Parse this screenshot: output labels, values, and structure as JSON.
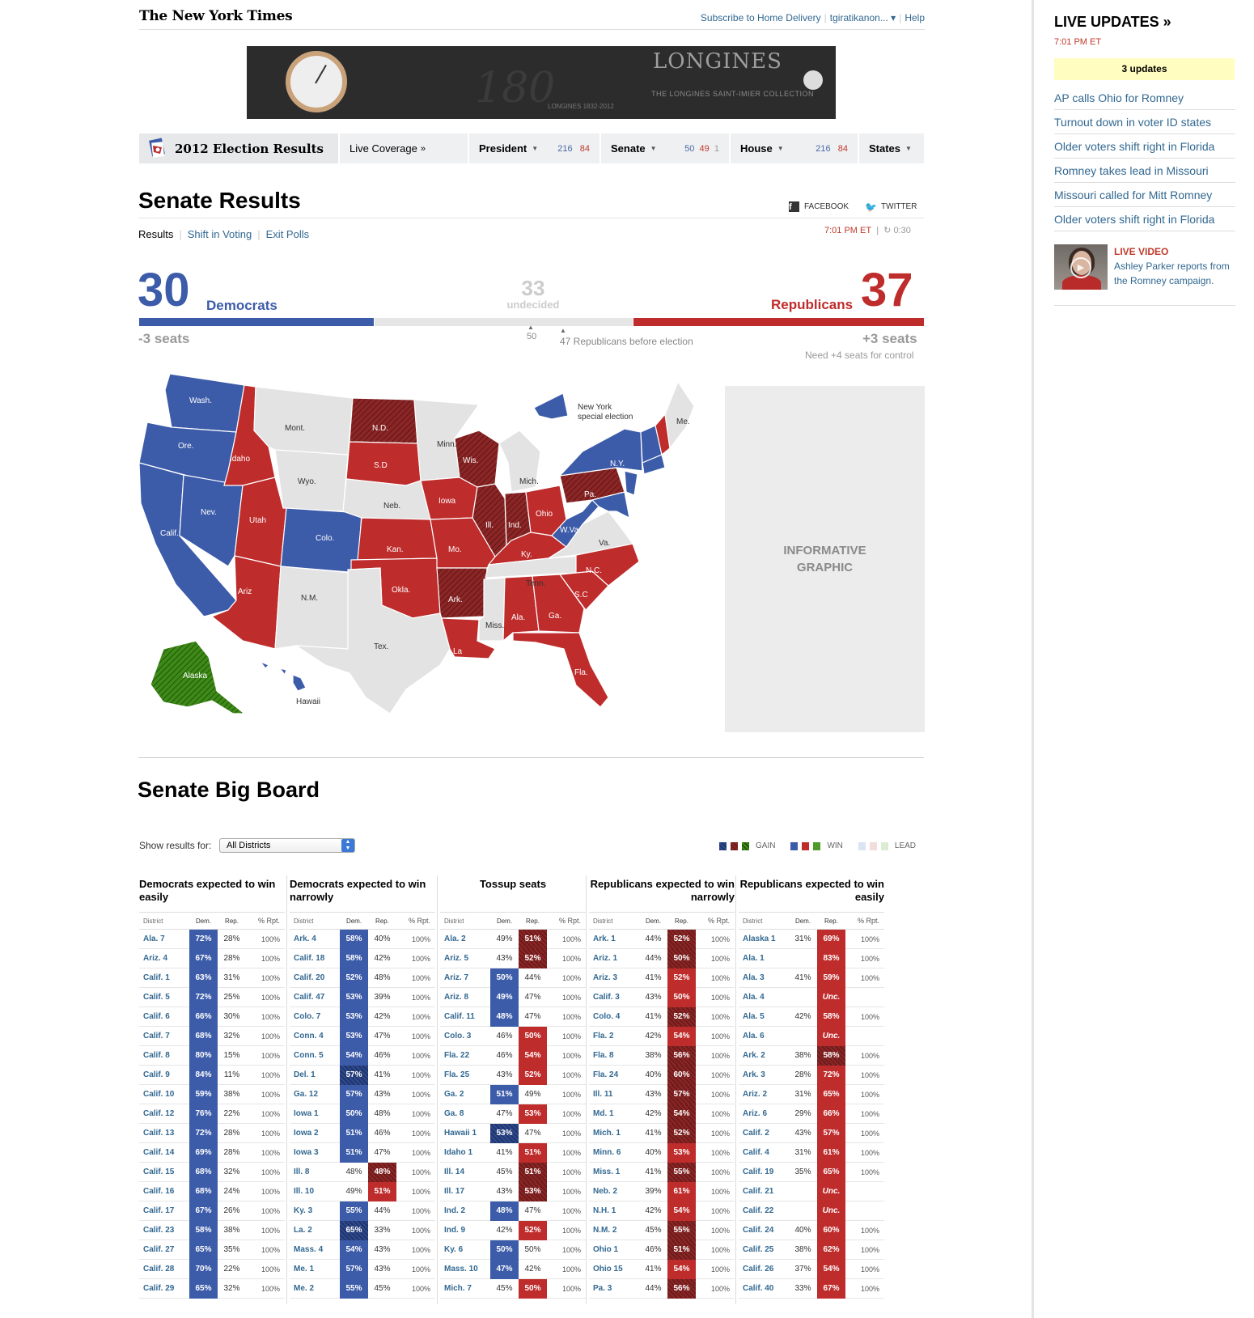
{
  "header": {
    "logo": "The New York Times",
    "subscribe": "Subscribe to Home Delivery",
    "user": "tgiratikanon... ▾",
    "help": "Help"
  },
  "ad": {
    "brand": "LONGINES",
    "number": "180",
    "tagline": "THE LONGINES SAINT-IMIER COLLECTION",
    "years": "LONGINES 1832-2012"
  },
  "nav": {
    "title": "2012 Election Results",
    "live": "Live Coverage",
    "live_arrow": "»",
    "president": {
      "label": "President",
      "dem": "216",
      "rep": "84"
    },
    "senate": {
      "label": "Senate",
      "dem": "50",
      "rep": "49",
      "und": "1"
    },
    "house": {
      "label": "House",
      "dem": "216",
      "rep": "84"
    },
    "states": "States"
  },
  "page": {
    "title": "Senate Results",
    "facebook": "FACEBOOK",
    "twitter": "TWITTER",
    "subnav": [
      "Results",
      "Shift in Voting",
      "Exit Polls"
    ],
    "time": "7:01 PM ET",
    "countdown": "0:30"
  },
  "scoreboard": {
    "dem_seats": "30",
    "dem_label": "Democrats",
    "dem_change": "-3 seats",
    "rep_seats": "37",
    "rep_label": "Republicans",
    "rep_change": "+3 seats",
    "undecided": "33",
    "undecided_label": "undecided",
    "mark_50": "50",
    "mark_47": "47 Republicans before election",
    "need_control": "Need +4 seats for control",
    "totals": {
      "dem": 30,
      "undecided": 33,
      "rep": 37,
      "total": 100
    }
  },
  "map": {
    "labels": {
      "wash": "Wash.",
      "ore": "Ore.",
      "calif": "Calif.",
      "nev": "Nev.",
      "idaho": "Idaho",
      "mont": "Mont.",
      "wyo": "Wyo.",
      "utah": "Utah",
      "colo": "Colo.",
      "ariz": "Ariz",
      "nm": "N.M.",
      "nd": "N.D.",
      "sd": "S.D",
      "neb": "Neb.",
      "kan": "Kan.",
      "okla": "Okla.",
      "tex": "Tex.",
      "minn": "Minn.",
      "iowa": "Iowa",
      "mo": "Mo.",
      "ark": "Ark.",
      "la": "La",
      "wis": "Wis.",
      "ill": "Ill.",
      "mich": "Mich.",
      "ind": "Ind.",
      "ohio": "Ohio",
      "ky": "Ky.",
      "tenn": "Tenn.",
      "miss": "Miss.",
      "ala": "Ala.",
      "ga": "Ga.",
      "fla": "Fla.",
      "sc": "S.C",
      "nc": "N.C.",
      "va": "Va.",
      "wva": "W.Va.",
      "pa": "Pa.",
      "ny": "N.Y.",
      "me": "Me.",
      "alaska": "Alaska",
      "hawaii": "Hawaii",
      "ny_special": "New York",
      "ny_special2": "special election"
    },
    "colors": {
      "dem": "#3c5ba9",
      "rep": "#bf2c2c",
      "rep_gain": "#8c2626",
      "neutral": "#e3e3e3",
      "other": "#2f7a12"
    },
    "placeholder": "INFORMATIVE GRAPHIC"
  },
  "bigboard": {
    "title": "Senate Big Board",
    "show_label": "Show results for:",
    "select_value": "All Districts",
    "legend": {
      "gain": "GAIN",
      "win": "WIN",
      "lead": "LEAD"
    },
    "col_headers": {
      "district": "District",
      "dem": "Dem.",
      "rep": "Rep.",
      "rpt": "% Rpt."
    },
    "columns": [
      {
        "title": "Democrats expected to win easily",
        "rows": [
          [
            "Ala. 7",
            "72%",
            "28%",
            "100%",
            "d",
            ""
          ],
          [
            "Ariz. 4",
            "67%",
            "28%",
            "100%",
            "d",
            ""
          ],
          [
            "Calif. 1",
            "63%",
            "31%",
            "100%",
            "d",
            ""
          ],
          [
            "Calif. 5",
            "72%",
            "25%",
            "100%",
            "d",
            ""
          ],
          [
            "Calif. 6",
            "66%",
            "30%",
            "100%",
            "d",
            ""
          ],
          [
            "Calif. 7",
            "68%",
            "32%",
            "100%",
            "d",
            ""
          ],
          [
            "Calif. 8",
            "80%",
            "15%",
            "100%",
            "d",
            ""
          ],
          [
            "Calif. 9",
            "84%",
            "11%",
            "100%",
            "d",
            ""
          ],
          [
            "Calif. 10",
            "59%",
            "38%",
            "100%",
            "d",
            ""
          ],
          [
            "Calif. 12",
            "76%",
            "22%",
            "100%",
            "d",
            ""
          ],
          [
            "Calif. 13",
            "72%",
            "28%",
            "100%",
            "d",
            ""
          ],
          [
            "Calif. 14",
            "69%",
            "28%",
            "100%",
            "d",
            ""
          ],
          [
            "Calif. 15",
            "68%",
            "32%",
            "100%",
            "d",
            ""
          ],
          [
            "Calif. 16",
            "68%",
            "24%",
            "100%",
            "d",
            ""
          ],
          [
            "Calif. 17",
            "67%",
            "26%",
            "100%",
            "d",
            ""
          ],
          [
            "Calif. 23",
            "58%",
            "38%",
            "100%",
            "d",
            ""
          ],
          [
            "Calif. 27",
            "65%",
            "35%",
            "100%",
            "d",
            ""
          ],
          [
            "Calif. 28",
            "70%",
            "22%",
            "100%",
            "d",
            ""
          ],
          [
            "Calif. 29",
            "65%",
            "32%",
            "100%",
            "d",
            ""
          ]
        ]
      },
      {
        "title": "Democrats expected to win narrowly",
        "rows": [
          [
            "Ark. 4",
            "58%",
            "40%",
            "100%",
            "d",
            ""
          ],
          [
            "Calif. 18",
            "58%",
            "42%",
            "100%",
            "d",
            ""
          ],
          [
            "Calif. 20",
            "52%",
            "48%",
            "100%",
            "d",
            ""
          ],
          [
            "Calif. 47",
            "53%",
            "39%",
            "100%",
            "d",
            ""
          ],
          [
            "Colo. 7",
            "53%",
            "42%",
            "100%",
            "d",
            ""
          ],
          [
            "Conn. 4",
            "53%",
            "47%",
            "100%",
            "d",
            ""
          ],
          [
            "Conn. 5",
            "54%",
            "46%",
            "100%",
            "d",
            ""
          ],
          [
            "Del. 1",
            "57%",
            "41%",
            "100%",
            "dg",
            ""
          ],
          [
            "Ga. 12",
            "57%",
            "43%",
            "100%",
            "d",
            ""
          ],
          [
            "Iowa 1",
            "50%",
            "48%",
            "100%",
            "d",
            ""
          ],
          [
            "Iowa 2",
            "51%",
            "46%",
            "100%",
            "d",
            ""
          ],
          [
            "Iowa 3",
            "51%",
            "47%",
            "100%",
            "d",
            ""
          ],
          [
            "Ill. 8",
            "48%",
            "48%",
            "100%",
            "rg",
            ""
          ],
          [
            "Ill. 10",
            "49%",
            "51%",
            "100%",
            "r",
            ""
          ],
          [
            "Ky. 3",
            "55%",
            "44%",
            "100%",
            "d",
            ""
          ],
          [
            "La. 2",
            "65%",
            "33%",
            "100%",
            "dg",
            ""
          ],
          [
            "Mass. 4",
            "54%",
            "43%",
            "100%",
            "d",
            ""
          ],
          [
            "Me. 1",
            "57%",
            "43%",
            "100%",
            "d",
            ""
          ],
          [
            "Me. 2",
            "55%",
            "45%",
            "100%",
            "d",
            ""
          ]
        ]
      },
      {
        "title": "Tossup seats",
        "rows": [
          [
            "Ala. 2",
            "49%",
            "51%",
            "100%",
            "rg",
            ""
          ],
          [
            "Ariz. 5",
            "43%",
            "52%",
            "100%",
            "rg",
            ""
          ],
          [
            "Ariz. 7",
            "50%",
            "44%",
            "100%",
            "d",
            ""
          ],
          [
            "Ariz. 8",
            "49%",
            "47%",
            "100%",
            "d",
            ""
          ],
          [
            "Calif. 11",
            "48%",
            "47%",
            "100%",
            "d",
            ""
          ],
          [
            "Colo. 3",
            "46%",
            "50%",
            "100%",
            "r",
            ""
          ],
          [
            "Fla. 22",
            "46%",
            "54%",
            "100%",
            "r",
            ""
          ],
          [
            "Fla. 25",
            "43%",
            "52%",
            "100%",
            "r",
            ""
          ],
          [
            "Ga. 2",
            "51%",
            "49%",
            "100%",
            "d",
            ""
          ],
          [
            "Ga. 8",
            "47%",
            "53%",
            "100%",
            "r",
            ""
          ],
          [
            "Hawaii 1",
            "53%",
            "47%",
            "100%",
            "dg",
            ""
          ],
          [
            "Idaho 1",
            "41%",
            "51%",
            "100%",
            "r",
            ""
          ],
          [
            "Ill. 14",
            "45%",
            "51%",
            "100%",
            "rg",
            ""
          ],
          [
            "Ill. 17",
            "43%",
            "53%",
            "100%",
            "rg",
            ""
          ],
          [
            "Ind. 2",
            "48%",
            "47%",
            "100%",
            "d",
            ""
          ],
          [
            "Ind. 9",
            "42%",
            "52%",
            "100%",
            "r",
            ""
          ],
          [
            "Ky. 6",
            "50%",
            "50%",
            "100%",
            "d",
            ""
          ],
          [
            "Mass. 10",
            "47%",
            "42%",
            "100%",
            "d",
            ""
          ],
          [
            "Mich. 7",
            "45%",
            "50%",
            "100%",
            "r",
            ""
          ]
        ]
      },
      {
        "title": "Republicans expected to win narrowly",
        "rows": [
          [
            "Ark. 1",
            "44%",
            "52%",
            "100%",
            "rg",
            ""
          ],
          [
            "Ariz. 1",
            "44%",
            "50%",
            "100%",
            "rg",
            ""
          ],
          [
            "Ariz. 3",
            "41%",
            "52%",
            "100%",
            "r",
            ""
          ],
          [
            "Calif. 3",
            "43%",
            "50%",
            "100%",
            "r",
            ""
          ],
          [
            "Colo. 4",
            "41%",
            "52%",
            "100%",
            "rg",
            ""
          ],
          [
            "Fla. 2",
            "42%",
            "54%",
            "100%",
            "r",
            ""
          ],
          [
            "Fla. 8",
            "38%",
            "56%",
            "100%",
            "rg",
            ""
          ],
          [
            "Fla. 24",
            "40%",
            "60%",
            "100%",
            "rg",
            ""
          ],
          [
            "Ill. 11",
            "43%",
            "57%",
            "100%",
            "rg",
            ""
          ],
          [
            "Md. 1",
            "42%",
            "54%",
            "100%",
            "rg",
            ""
          ],
          [
            "Mich. 1",
            "41%",
            "52%",
            "100%",
            "rg",
            ""
          ],
          [
            "Minn. 6",
            "40%",
            "53%",
            "100%",
            "r",
            ""
          ],
          [
            "Miss. 1",
            "41%",
            "55%",
            "100%",
            "rg",
            ""
          ],
          [
            "Neb. 2",
            "39%",
            "61%",
            "100%",
            "r",
            ""
          ],
          [
            "N.H. 1",
            "42%",
            "54%",
            "100%",
            "r",
            ""
          ],
          [
            "N.M. 2",
            "45%",
            "55%",
            "100%",
            "rg",
            ""
          ],
          [
            "Ohio 1",
            "46%",
            "51%",
            "100%",
            "rg",
            ""
          ],
          [
            "Ohio 15",
            "41%",
            "54%",
            "100%",
            "r",
            ""
          ],
          [
            "Pa. 3",
            "44%",
            "56%",
            "100%",
            "rg",
            ""
          ]
        ]
      },
      {
        "title": "Republicans expected to win easily",
        "rows": [
          [
            "Alaska 1",
            "31%",
            "69%",
            "100%",
            "r",
            ""
          ],
          [
            "Ala. 1",
            "",
            "83%",
            "100%",
            "r",
            ""
          ],
          [
            "Ala. 3",
            "41%",
            "59%",
            "100%",
            "r",
            ""
          ],
          [
            "Ala. 4",
            "",
            "Unc.",
            "",
            "r",
            "unc"
          ],
          [
            "Ala. 5",
            "42%",
            "58%",
            "100%",
            "r",
            ""
          ],
          [
            "Ala. 6",
            "",
            "Unc.",
            "",
            "r",
            "unc"
          ],
          [
            "Ark. 2",
            "38%",
            "58%",
            "100%",
            "rg",
            ""
          ],
          [
            "Ark. 3",
            "28%",
            "72%",
            "100%",
            "r",
            ""
          ],
          [
            "Ariz. 2",
            "31%",
            "65%",
            "100%",
            "r",
            ""
          ],
          [
            "Ariz. 6",
            "29%",
            "66%",
            "100%",
            "r",
            ""
          ],
          [
            "Calif. 2",
            "43%",
            "57%",
            "100%",
            "r",
            ""
          ],
          [
            "Calif. 4",
            "31%",
            "61%",
            "100%",
            "r",
            ""
          ],
          [
            "Calif. 19",
            "35%",
            "65%",
            "100%",
            "r",
            ""
          ],
          [
            "Calif. 21",
            "",
            "Unc.",
            "",
            "r",
            "unc"
          ],
          [
            "Calif. 22",
            "",
            "Unc.",
            "",
            "r",
            "unc"
          ],
          [
            "Calif. 24",
            "40%",
            "60%",
            "100%",
            "r",
            ""
          ],
          [
            "Calif. 25",
            "38%",
            "62%",
            "100%",
            "r",
            ""
          ],
          [
            "Calif. 26",
            "37%",
            "54%",
            "100%",
            "r",
            ""
          ],
          [
            "Calif. 40",
            "33%",
            "67%",
            "100%",
            "r",
            ""
          ]
        ]
      }
    ]
  },
  "sidebar": {
    "title": "LIVE UPDATES »",
    "time": "7:01 PM ET",
    "updates": "3 updates",
    "items": [
      "AP calls Ohio for Romney",
      "Turnout down in voter ID states",
      "Older voters shift right in Florida",
      "Romney takes lead in Missouri",
      "Missouri called for Mitt Romney",
      "Older voters shift right in Florida"
    ],
    "video_label": "LIVE VIDEO",
    "video_text": "Ashley Parker reports from the Romney campaign."
  }
}
